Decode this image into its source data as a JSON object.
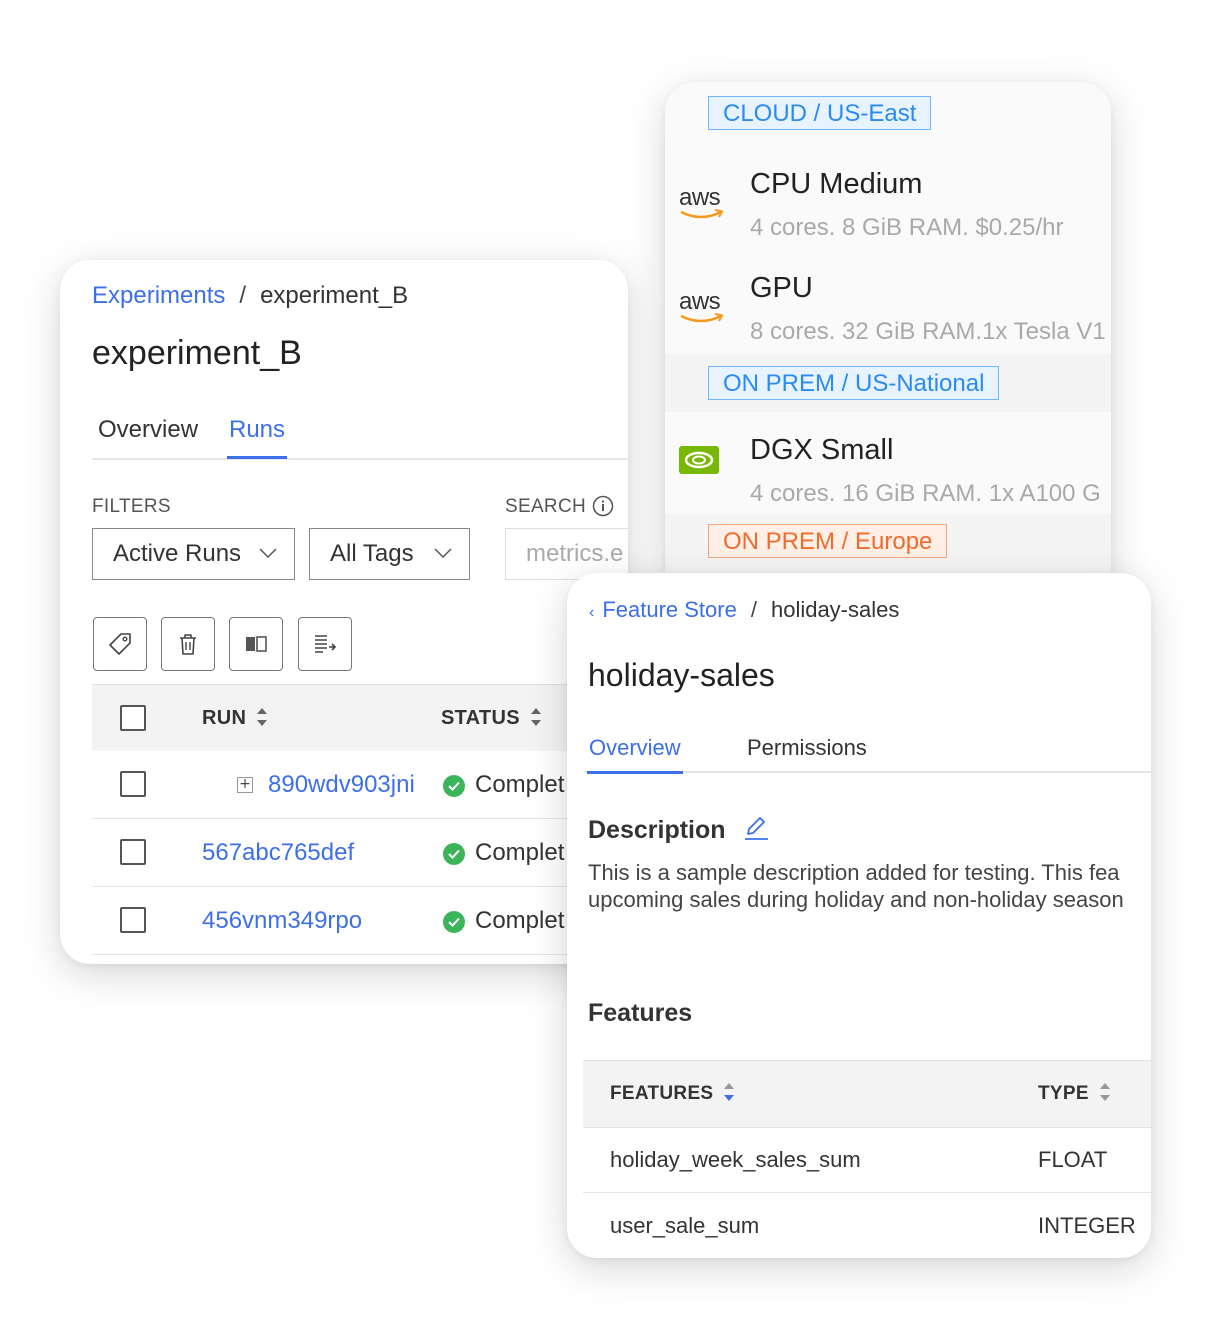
{
  "compute": {
    "regions": [
      {
        "label": "CLOUD / US-East",
        "color": "blue",
        "machines": [
          {
            "logo": "aws-logo",
            "logo_text": "aws",
            "name": "CPU Medium",
            "spec": "4 cores. 8 GiB RAM. $0.25/hr"
          },
          {
            "logo": "aws-logo",
            "logo_text": "aws",
            "name": "GPU",
            "spec": "8 cores. 32 GiB RAM.1x Tesla V1"
          }
        ]
      },
      {
        "label": "ON PREM / US-National",
        "color": "blue",
        "machines": [
          {
            "logo": "nvidia-logo",
            "name": "DGX Small",
            "spec": "4 cores. 16 GiB RAM. 1x A100 G"
          }
        ]
      },
      {
        "label": "ON PREM / Europe",
        "color": "orange",
        "machines": []
      }
    ]
  },
  "experiment": {
    "breadcrumb": {
      "parent": "Experiments",
      "separator": "/",
      "current": "experiment_B"
    },
    "title": "experiment_B",
    "tabs": [
      "Overview",
      "Runs"
    ],
    "active_tab": "Runs",
    "filters_label": "FILTERS",
    "search_label": "SEARCH",
    "filter_runs": "Active Runs",
    "filter_tags": "All Tags",
    "search_placeholder": "metrics.e",
    "toolbar": [
      "tag-icon",
      "trash-icon",
      "columns-icon",
      "sort-lines-icon"
    ],
    "table": {
      "columns": [
        "RUN",
        "STATUS"
      ],
      "rows": [
        {
          "run": "890wdv903jni",
          "status": "Complet",
          "expandable": true,
          "expander": "+"
        },
        {
          "run": "567abc765def",
          "status": "Complet",
          "expandable": false
        },
        {
          "run": "456vnm349rpo",
          "status": "Complet",
          "expandable": false
        }
      ]
    }
  },
  "feature": {
    "breadcrumb": {
      "back": "‹",
      "parent": "Feature Store",
      "separator": "/",
      "current": "holiday-sales"
    },
    "title": "holiday-sales",
    "tabs": [
      "Overview",
      "Permissions"
    ],
    "active_tab": "Overview",
    "description_title": "Description",
    "description_line1": "This is a sample description added for testing. This fea",
    "description_line2": "upcoming sales during holiday and non-holiday season",
    "features_title": "Features",
    "table": {
      "columns": [
        "FEATURES",
        "TYPE"
      ],
      "rows": [
        {
          "name": "holiday_week_sales_sum",
          "type": "FLOAT"
        },
        {
          "name": "user_sale_sum",
          "type": "INTEGER"
        }
      ]
    }
  },
  "colors": {
    "link": "#3d6fe8",
    "badge_blue": "#2b8bf2",
    "badge_orange": "#f26b2c",
    "success": "#3cb55a",
    "nvidia": "#76b900"
  }
}
